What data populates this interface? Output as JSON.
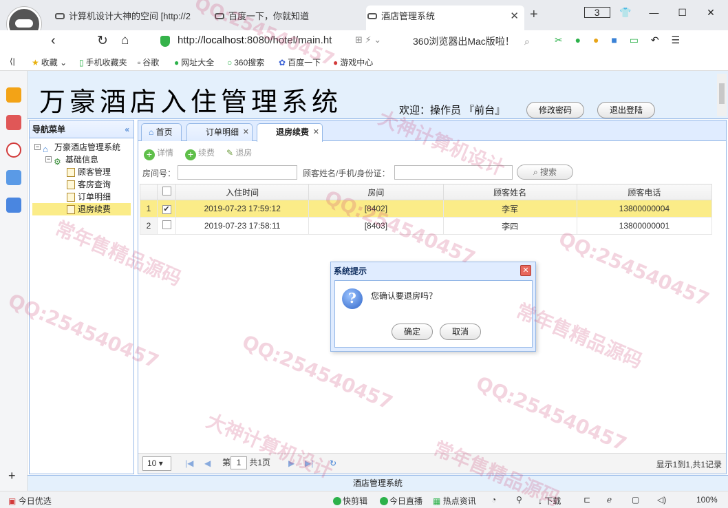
{
  "browser": {
    "tabs": [
      "计算机设计大神的空间 [http://2",
      "百度一下，你就知道",
      "酒店管理系统"
    ],
    "tab_count": "3",
    "url_prefix": "http://",
    "url_host": "localhost",
    "url_rest": ":8080/hotel/main.ht",
    "promo": "360浏览器出Mac版啦！",
    "bookmarks": [
      "收藏",
      "手机收藏夹",
      "谷歌",
      "网址大全",
      "360搜索",
      "百度一下",
      "游戏中心"
    ]
  },
  "app": {
    "title": "万豪酒店入住管理系统",
    "welcome": "欢迎：操作员 『前台』",
    "change_pwd": "修改密码",
    "logout": "退出登陆",
    "footer": "酒店管理系统"
  },
  "nav": {
    "header": "导航菜单",
    "root": "万豪酒店管理系统",
    "group": "基础信息",
    "items": [
      "顾客管理",
      "客房查询",
      "订单明细",
      "退房续费"
    ]
  },
  "tabs": [
    "首页",
    "订单明细",
    "退房续费"
  ],
  "toolbar": {
    "detail": "详情",
    "renew": "续费",
    "checkout": "退房"
  },
  "search": {
    "room_label": "房间号：",
    "guest_label": "顾客姓名/手机/身份证：",
    "button": "搜索"
  },
  "grid": {
    "columns": [
      "入住时间",
      "房间",
      "顾客姓名",
      "顾客电话"
    ],
    "rows": [
      {
        "n": "1",
        "time": "2019-07-23 17:59:12",
        "room": "[8402]",
        "name": "李军",
        "phone": "13800000004",
        "checked": true
      },
      {
        "n": "2",
        "time": "2019-07-23 17:58:11",
        "room": "[8403]",
        "name": "李四",
        "phone": "13800000001",
        "checked": false
      }
    ]
  },
  "pager": {
    "page_size": "10",
    "page_prefix": "第",
    "page": "1",
    "page_total": "共1页",
    "info": "显示1到1,共1记录"
  },
  "dialog": {
    "title": "系统提示",
    "message": "您确认要退房吗？",
    "ok": "确定",
    "cancel": "取消"
  },
  "statusbar": {
    "left": "今日优选",
    "items": [
      "快剪辑",
      "今日直播",
      "热点资讯",
      "下载"
    ],
    "zoom": "100%"
  },
  "watermarks": [
    "QQ:254540457",
    "大神计算机设计",
    "常年售精品源码"
  ]
}
